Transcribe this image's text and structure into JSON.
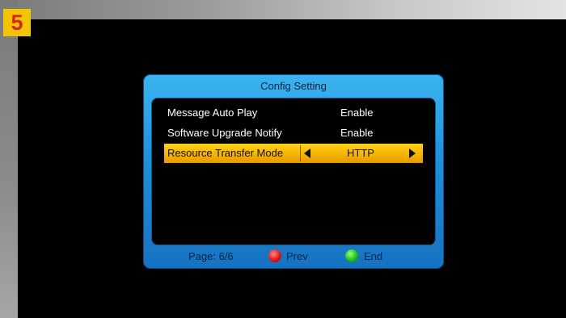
{
  "step_badge": "5",
  "dialog": {
    "title": "Config Setting",
    "rows": [
      {
        "label": "Message Auto Play",
        "value": "Enable"
      },
      {
        "label": "Software Upgrade Notify",
        "value": "Enable"
      },
      {
        "label": "Resource Transfer Mode",
        "value": "HTTP",
        "selected": true
      }
    ],
    "footer": {
      "page": "Page: 6/6",
      "red_button_label": "Prev",
      "green_button_label": "End"
    }
  },
  "colors": {
    "dialog_blue": "#1f8fd8",
    "highlight_yellow": "#f6b400",
    "badge_yellow": "#f5c400",
    "badge_red": "#d0281a"
  }
}
